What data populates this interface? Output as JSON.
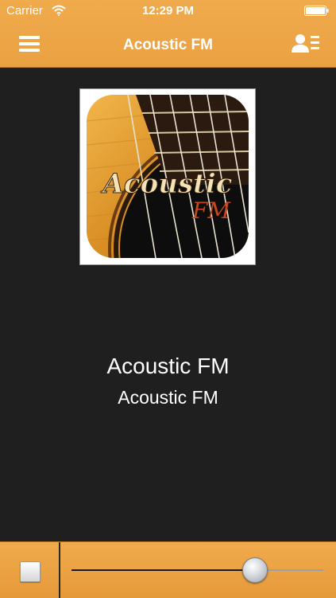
{
  "status_bar": {
    "carrier": "Carrier",
    "time": "12:29 PM"
  },
  "nav_bar": {
    "title": "Acoustic FM",
    "left_icon": "hamburger-menu-icon",
    "right_icon": "contacts-list-icon"
  },
  "artwork": {
    "logo_word": "Acoustic",
    "logo_sub": "FM"
  },
  "now_playing": {
    "title": "Acoustic FM",
    "subtitle": "Acoustic FM"
  },
  "player": {
    "stop_icon": "stop-icon",
    "volume": 0.75
  },
  "colors": {
    "accent": "#eba447",
    "background": "#1f1f1f",
    "text": "#ffffff"
  }
}
